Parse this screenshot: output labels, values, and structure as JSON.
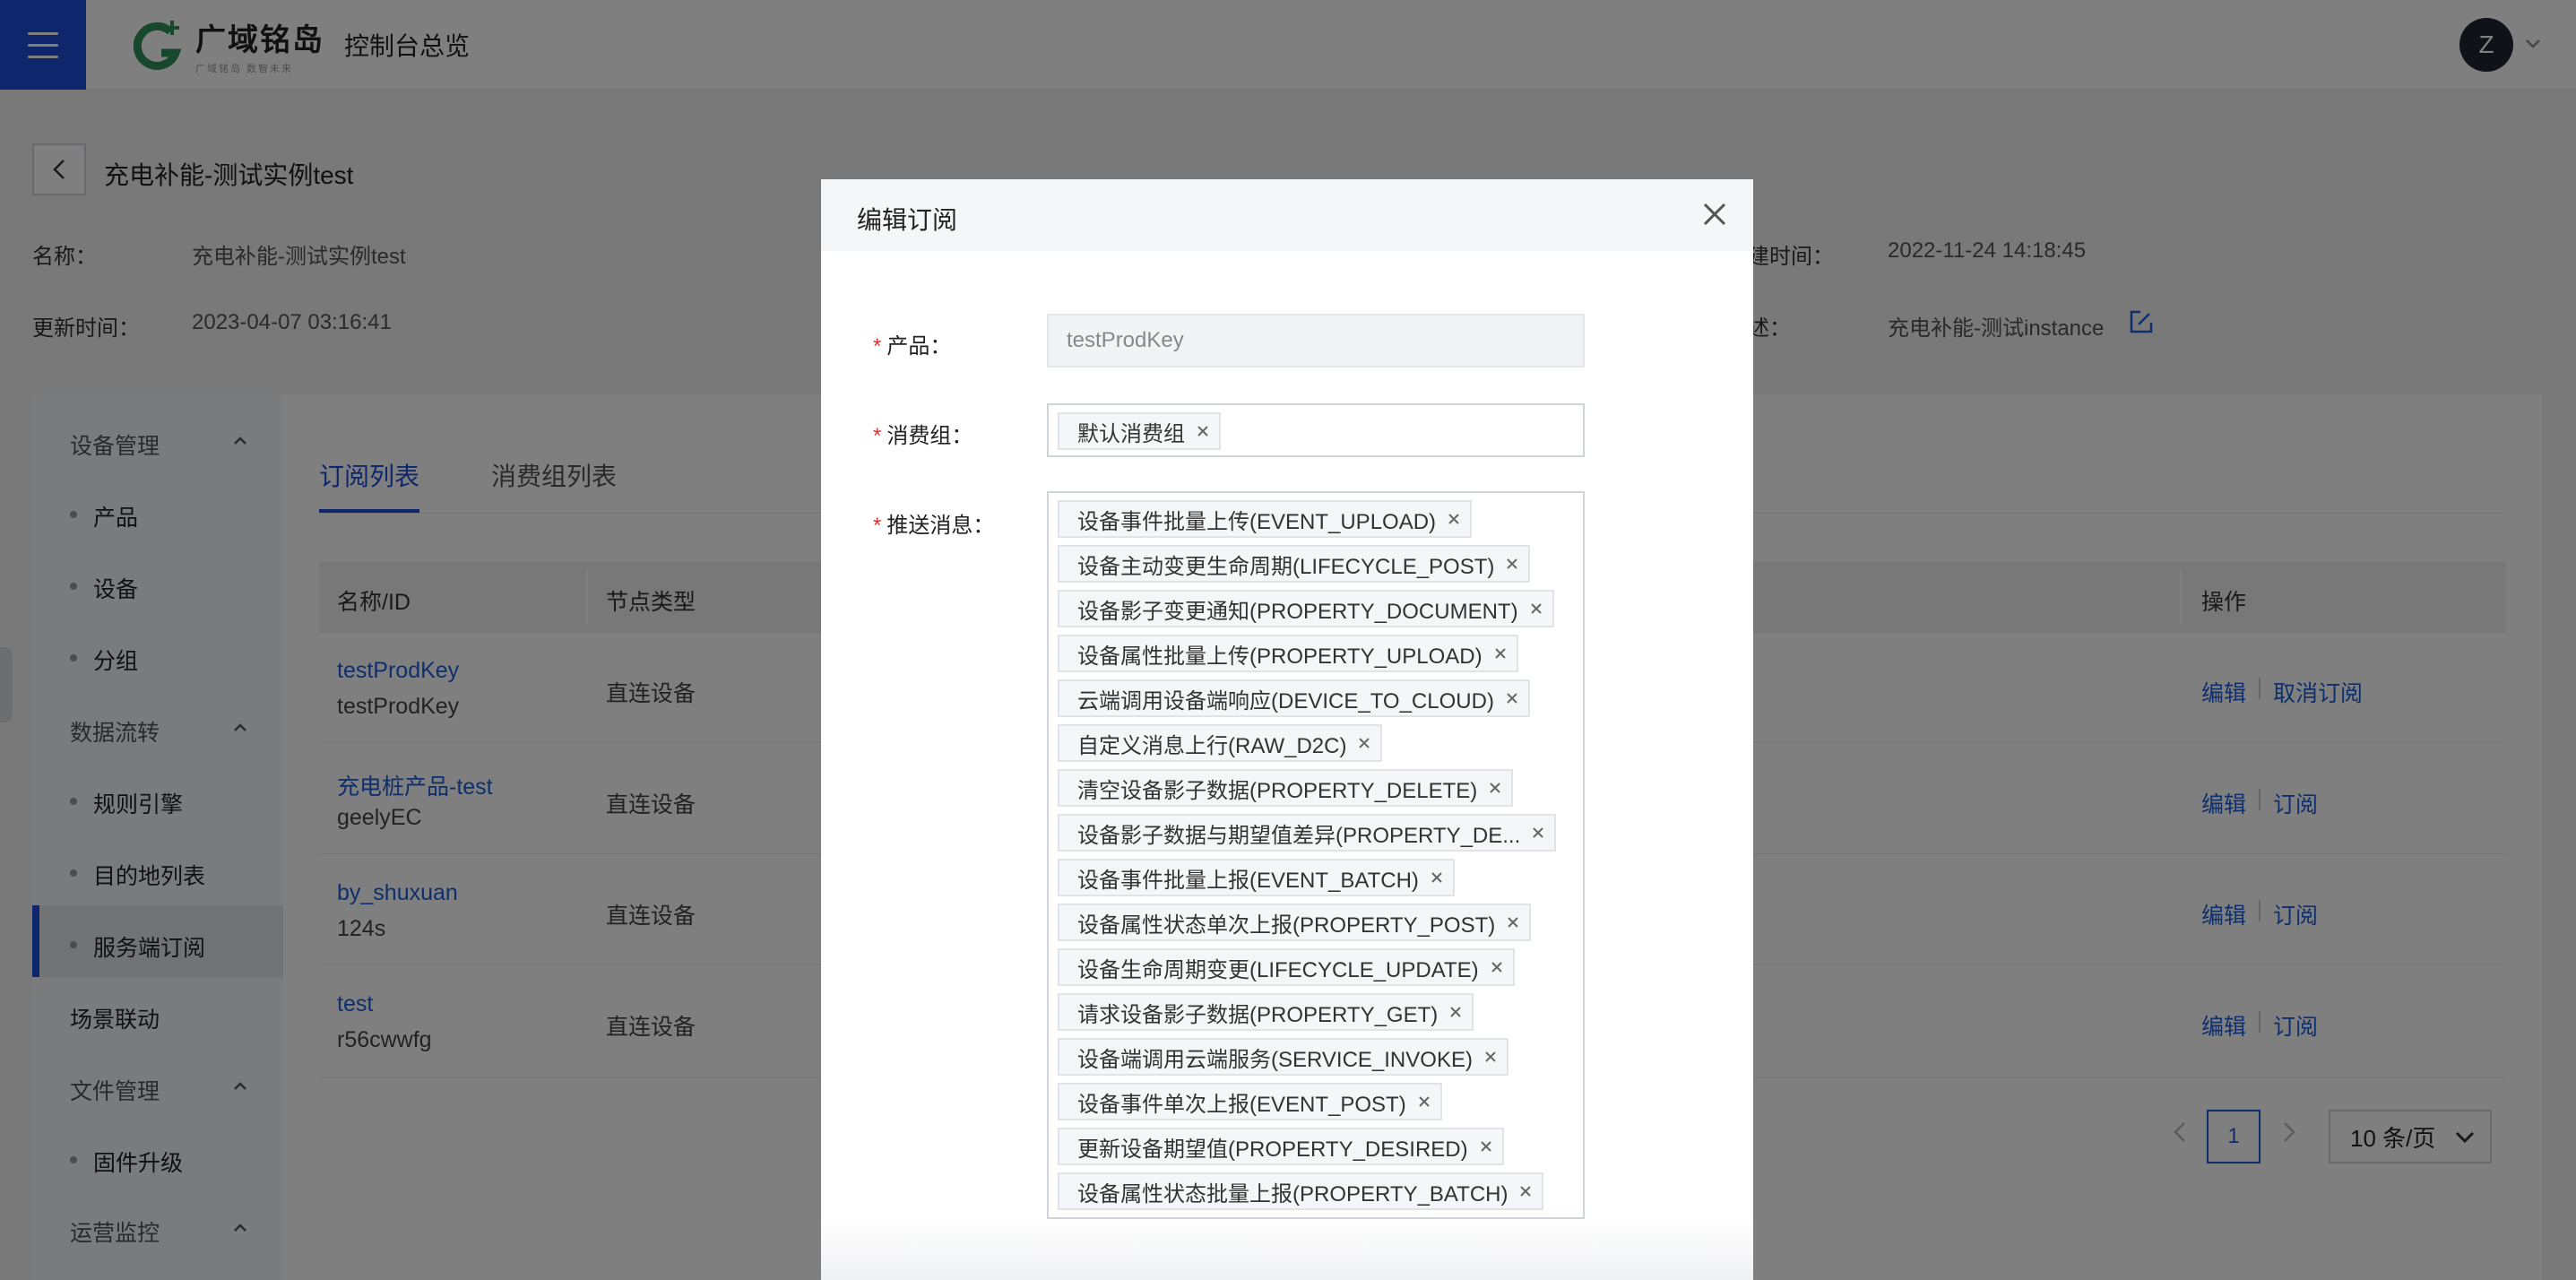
{
  "header": {
    "logo_name": "广域铭岛",
    "logo_sub": "广域铭岛 数智未来",
    "console_title": "控制台总览",
    "avatar_letter": "Z"
  },
  "instance": {
    "title": "充电补能-测试实例test",
    "name_label": "名称：",
    "name_value": "充电补能-测试实例test",
    "created_label": "建时间：",
    "created_value": "2022-11-24 14:18:45",
    "updated_label": "更新时间：",
    "updated_value": "2023-04-07 03:16:41",
    "desc_label": "述：",
    "desc_value": "充电补能-测试instance"
  },
  "sidebar": {
    "groups": [
      {
        "label": "设备管理",
        "items": [
          "产品",
          "设备",
          "分组"
        ]
      },
      {
        "label": "数据流转",
        "items": [
          "规则引擎",
          "目的地列表",
          "服务端订阅"
        ]
      },
      {
        "label": "场景联动"
      },
      {
        "label": "文件管理",
        "items": [
          "固件升级"
        ]
      },
      {
        "label": "运营监控"
      }
    ],
    "active_item": "服务端订阅"
  },
  "tabs": [
    {
      "label": "订阅列表",
      "active": true
    },
    {
      "label": "消费组列表",
      "active": false
    }
  ],
  "table": {
    "columns": [
      "名称/ID",
      "节点类型",
      "操作"
    ],
    "rows": [
      {
        "name": "testProdKey",
        "id": "testProdKey",
        "node_type": "直连设备",
        "ops": [
          "编辑",
          "取消订阅"
        ]
      },
      {
        "name": "充电桩产品-test",
        "id": "geelyEC",
        "node_type": "直连设备",
        "ops": [
          "编辑",
          "订阅"
        ]
      },
      {
        "name": "by_shuxuan",
        "id": "124s",
        "node_type": "直连设备",
        "ops": [
          "编辑",
          "订阅"
        ]
      },
      {
        "name": "test",
        "id": "r56cwwfg",
        "node_type": "直连设备",
        "ops": [
          "编辑",
          "订阅"
        ]
      }
    ]
  },
  "pagination": {
    "current_page": "1",
    "page_size": "10 条/页"
  },
  "modal": {
    "title": "编辑订阅",
    "product_label": "产品：",
    "product_value": "testProdKey",
    "group_label": "消费组：",
    "group_tags": [
      "默认消费组"
    ],
    "push_label": "推送消息：",
    "push_tags": [
      "设备事件批量上传(EVENT_UPLOAD)",
      "设备主动变更生命周期(LIFECYCLE_POST)",
      "设备影子变更通知(PROPERTY_DOCUMENT)",
      "设备属性批量上传(PROPERTY_UPLOAD)",
      "云端调用设备端响应(DEVICE_TO_CLOUD)",
      "自定义消息上行(RAW_D2C)",
      "清空设备影子数据(PROPERTY_DELETE)",
      "设备影子数据与期望值差异(PROPERTY_DE...",
      "设备事件批量上报(EVENT_BATCH)",
      "设备属性状态单次上报(PROPERTY_POST)",
      "设备生命周期变更(LIFECYCLE_UPDATE)",
      "请求设备影子数据(PROPERTY_GET)",
      "设备端调用云端服务(SERVICE_INVOKE)",
      "设备事件单次上报(EVENT_POST)",
      "更新设备期望值(PROPERTY_DESIRED)",
      "设备属性状态批量上报(PROPERTY_BATCH)"
    ]
  },
  "colors": {
    "primary": "#1d4fd8",
    "link": "#1d5fd8",
    "required": "#e0312a"
  }
}
